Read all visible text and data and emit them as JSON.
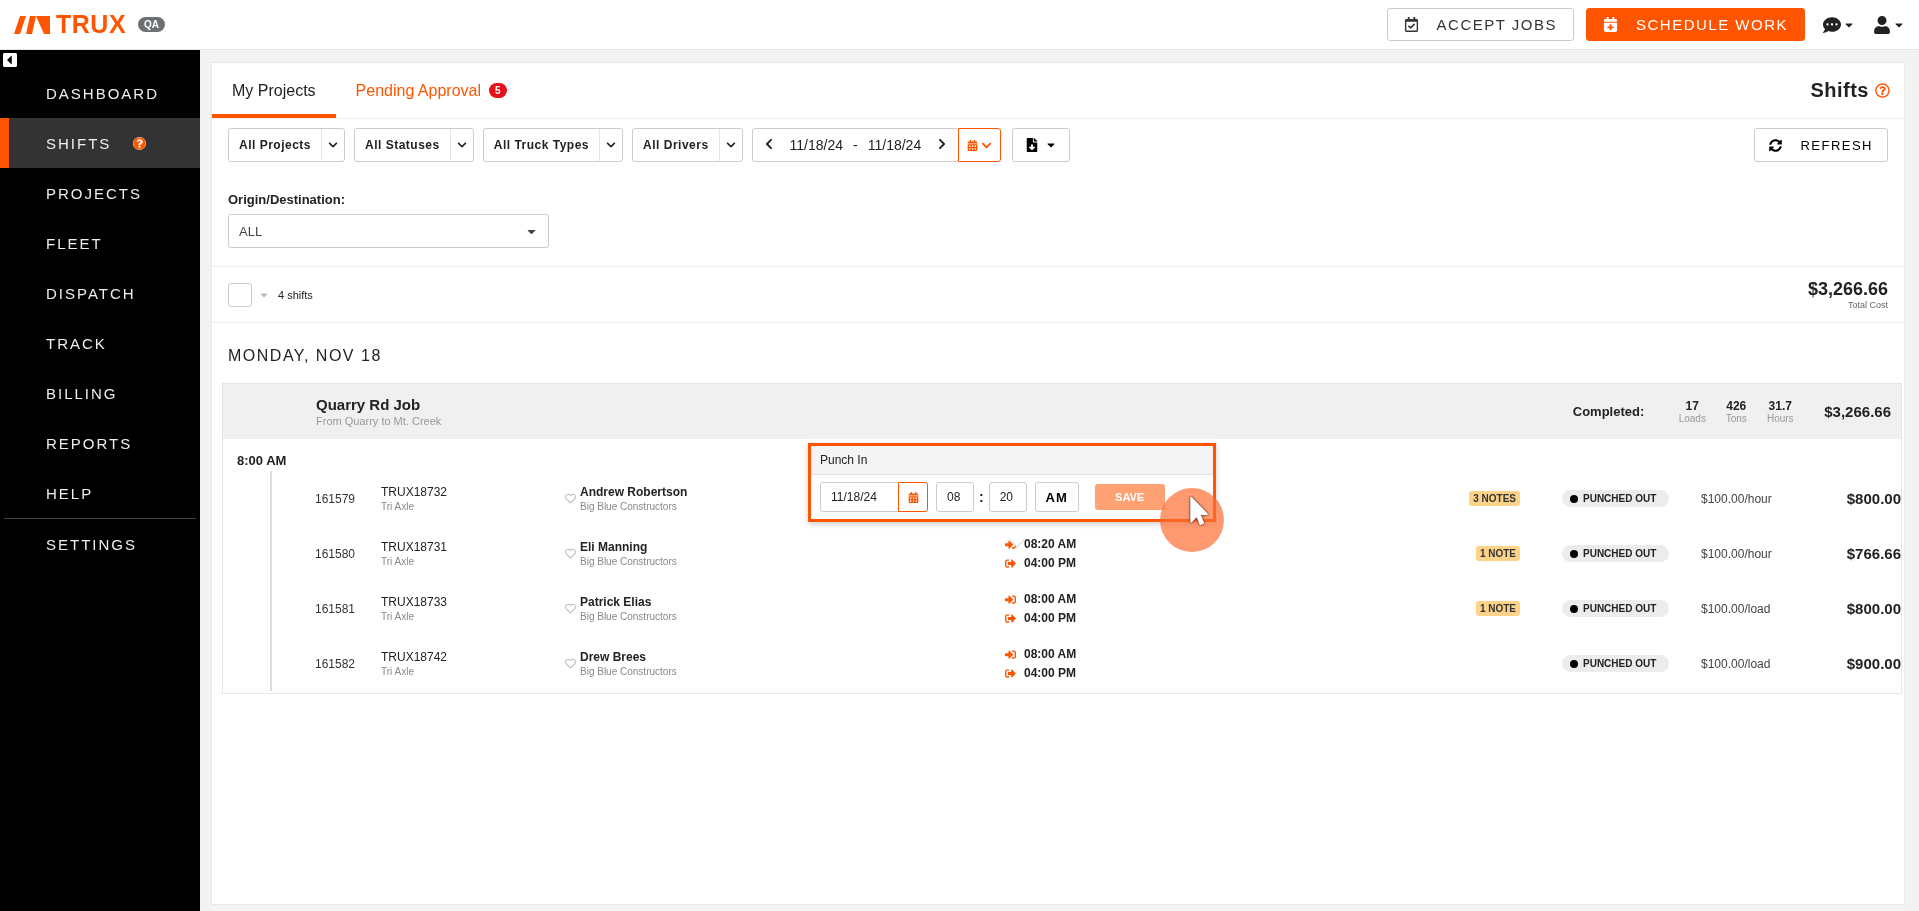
{
  "header": {
    "brand": "TRUX",
    "env_badge": "QA",
    "buttons": [
      {
        "kind": "outline",
        "label": "ACCEPT JOBS"
      },
      {
        "kind": "primary",
        "label": "SCHEDULE WORK"
      }
    ]
  },
  "sidebar": {
    "items": [
      {
        "label": "DASHBOARD",
        "selected": false,
        "help": false
      },
      {
        "label": "SHIFTS",
        "selected": true,
        "help": true
      },
      {
        "label": "PROJECTS",
        "selected": false,
        "help": false
      },
      {
        "label": "FLEET",
        "selected": false,
        "help": false
      },
      {
        "label": "DISPATCH",
        "selected": false,
        "help": false
      },
      {
        "label": "TRACK",
        "selected": false,
        "help": false
      },
      {
        "label": "BILLING",
        "selected": false,
        "help": false
      },
      {
        "label": "REPORTS",
        "selected": false,
        "help": false
      },
      {
        "label": "HELP",
        "selected": false,
        "help": false
      },
      {
        "label": "SETTINGS",
        "selected": false,
        "help": false
      }
    ]
  },
  "tabs": [
    {
      "label": "My Projects",
      "selected": true
    },
    {
      "label": "Pending Approval",
      "selected": false,
      "badge": "5"
    }
  ],
  "page_title": "Shifts",
  "filters": [
    "All Projects",
    "All Statuses",
    "All Truck Types",
    "All Drivers"
  ],
  "date_range": {
    "start": "11/18/24",
    "separator": "-",
    "end": "11/18/24"
  },
  "refresh_button": "REFRESH",
  "origin_destination": {
    "label": "Origin/Destination:",
    "value": "ALL"
  },
  "summary": {
    "select_all_checked": false,
    "count": "4 shifts",
    "total": "$3,266.66",
    "total_label": "Total Cost"
  },
  "day_heading": "MONDAY, NOV 18",
  "group": {
    "title": "Quarry Rd Job",
    "subtitle": "From Quarry to Mt. Creek",
    "completed_label": "Completed:",
    "stats": [
      {
        "value": "17",
        "label": "Loads"
      },
      {
        "value": "426",
        "label": "Tons"
      },
      {
        "value": "31.7",
        "label": "Hours"
      }
    ],
    "amount": "$3,266.66",
    "start_time": "8:00 AM",
    "rows": [
      {
        "id": "161579",
        "truck": "TRUX18732",
        "truck_type": "Tri Axle",
        "driver": "Andrew Robertson",
        "company": "Big Blue Constructors",
        "notes": "3 NOTES",
        "status": "PUNCHED OUT",
        "rate": "$100.00/hour",
        "amount": "$800.00"
      },
      {
        "id": "161580",
        "truck": "TRUX18731",
        "truck_type": "Tri Axle",
        "driver": "Eli Manning",
        "company": "Big Blue Constructors",
        "punch_in": "08:20 AM",
        "punch_out": "04:00 PM",
        "notes": "1 NOTE",
        "status": "PUNCHED OUT",
        "rate": "$100.00/hour",
        "amount": "$766.66"
      },
      {
        "id": "161581",
        "truck": "TRUX18733",
        "truck_type": "Tri Axle",
        "driver": "Patrick Elias",
        "company": "Big Blue Constructors",
        "punch_in": "08:00 AM",
        "punch_out": "04:00 PM",
        "notes": "1 NOTE",
        "status": "PUNCHED OUT",
        "rate": "$100.00/load",
        "amount": "$800.00"
      },
      {
        "id": "161582",
        "truck": "TRUX18742",
        "truck_type": "Tri Axle",
        "driver": "Drew Brees",
        "company": "Big Blue Constructors",
        "punch_in": "08:00 AM",
        "punch_out": "04:00 PM",
        "status": "PUNCHED OUT",
        "rate": "$100.00/load",
        "amount": "$900.00"
      }
    ]
  },
  "punch_popup": {
    "title": "Punch In",
    "date": "11/18/24",
    "hour": "08",
    "colon": ":",
    "minute": "20",
    "meridiem": "AM",
    "save": "SAVE",
    "save_disabled": true
  }
}
